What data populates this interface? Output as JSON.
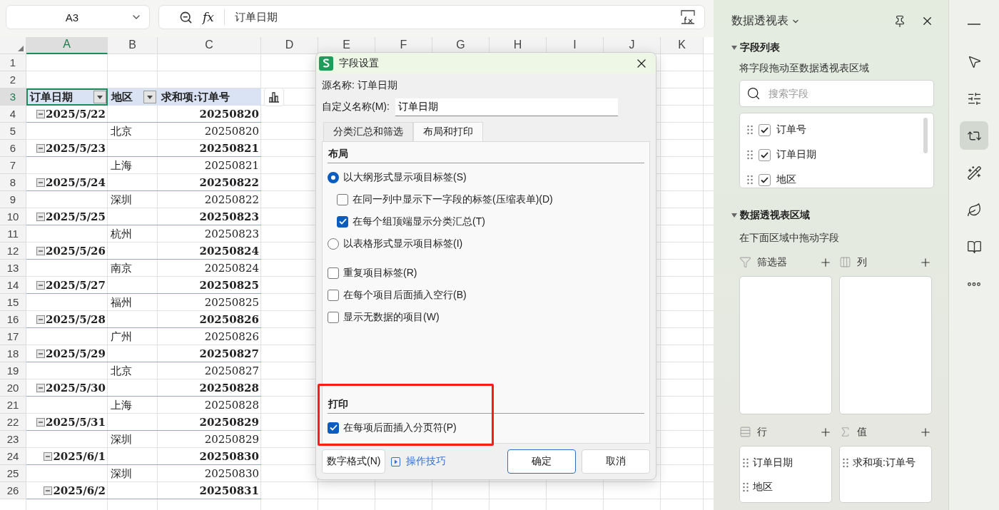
{
  "name_box": {
    "value": "A3"
  },
  "formula_bar": {
    "fx": "fx",
    "value": "订单日期"
  },
  "sheet": {
    "columns": [
      {
        "label": "A",
        "selected": true
      },
      {
        "label": "B",
        "selected": false
      },
      {
        "label": "C",
        "selected": false
      },
      {
        "label": "D",
        "selected": false
      },
      {
        "label": "E",
        "selected": false
      },
      {
        "label": "F",
        "selected": false
      },
      {
        "label": "G",
        "selected": false
      },
      {
        "label": "H",
        "selected": false
      },
      {
        "label": "I",
        "selected": false
      },
      {
        "label": "J",
        "selected": false
      },
      {
        "label": "K",
        "selected": false
      }
    ],
    "rows": [
      {
        "number": "1",
        "kind": "empty",
        "selected": false
      },
      {
        "number": "2",
        "kind": "empty",
        "selected": false
      },
      {
        "number": "3",
        "kind": "header",
        "selected": true,
        "cells": [
          {
            "label": "订单日期",
            "filter": true,
            "selected": true
          },
          {
            "label": "地区",
            "filter": true,
            "selected": false
          },
          {
            "label": "求和项:订单号",
            "filter": false,
            "selected": false
          }
        ]
      },
      {
        "number": "4",
        "kind": "date",
        "selected": false,
        "label": "2025/5/22",
        "value": "20250820",
        "expanded": true
      },
      {
        "number": "5",
        "kind": "region",
        "selected": false,
        "label": "北京",
        "value": "20250820"
      },
      {
        "number": "6",
        "kind": "date",
        "selected": false,
        "label": "2025/5/23",
        "value": "20250821",
        "expanded": true
      },
      {
        "number": "7",
        "kind": "region",
        "selected": false,
        "label": "上海",
        "value": "20250821"
      },
      {
        "number": "8",
        "kind": "date",
        "selected": false,
        "label": "2025/5/24",
        "value": "20250822",
        "expanded": true
      },
      {
        "number": "9",
        "kind": "region",
        "selected": false,
        "label": "深圳",
        "value": "20250822"
      },
      {
        "number": "10",
        "kind": "date",
        "selected": false,
        "label": "2025/5/25",
        "value": "20250823",
        "expanded": true
      },
      {
        "number": "11",
        "kind": "region",
        "selected": false,
        "label": "杭州",
        "value": "20250823"
      },
      {
        "number": "12",
        "kind": "date",
        "selected": false,
        "label": "2025/5/26",
        "value": "20250824",
        "expanded": true
      },
      {
        "number": "13",
        "kind": "region",
        "selected": false,
        "label": "南京",
        "value": "20250824"
      },
      {
        "number": "14",
        "kind": "date",
        "selected": false,
        "label": "2025/5/27",
        "value": "20250825",
        "expanded": true
      },
      {
        "number": "15",
        "kind": "region",
        "selected": false,
        "label": "福州",
        "value": "20250825"
      },
      {
        "number": "16",
        "kind": "date",
        "selected": false,
        "label": "2025/5/28",
        "value": "20250826",
        "expanded": true
      },
      {
        "number": "17",
        "kind": "region",
        "selected": false,
        "label": "广州",
        "value": "20250826"
      },
      {
        "number": "18",
        "kind": "date",
        "selected": false,
        "label": "2025/5/29",
        "value": "20250827",
        "expanded": true
      },
      {
        "number": "19",
        "kind": "region",
        "selected": false,
        "label": "北京",
        "value": "20250827"
      },
      {
        "number": "20",
        "kind": "date",
        "selected": false,
        "label": "2025/5/30",
        "value": "20250828",
        "expanded": true
      },
      {
        "number": "21",
        "kind": "region",
        "selected": false,
        "label": "上海",
        "value": "20250828"
      },
      {
        "number": "22",
        "kind": "date",
        "selected": false,
        "label": "2025/5/31",
        "value": "20250829",
        "expanded": true
      },
      {
        "number": "23",
        "kind": "region",
        "selected": false,
        "label": "深圳",
        "value": "20250829"
      },
      {
        "number": "24",
        "kind": "date",
        "selected": false,
        "label": "2025/6/1",
        "value": "20250830",
        "expanded": true
      },
      {
        "number": "25",
        "kind": "region",
        "selected": false,
        "label": "深圳",
        "value": "20250830"
      },
      {
        "number": "26",
        "kind": "date",
        "selected": false,
        "label": "2025/6/2",
        "value": "20250831",
        "expanded": true
      }
    ]
  },
  "dialog": {
    "title": "字段设置",
    "source_label": "源名称: 订单日期",
    "custom_name_label": "自定义名称(M):",
    "custom_name_value": "订单日期",
    "tabs": [
      {
        "label": "分类汇总和筛选",
        "selected": false
      },
      {
        "label": "布局和打印",
        "selected": true
      }
    ],
    "sections": [
      {
        "title": "布局",
        "highlighted": false,
        "options": [
          {
            "kind": "radio",
            "label": "以大纲形式显示项目标签(S)",
            "selected": true,
            "children": [
              {
                "kind": "checkbox",
                "label": "在同一列中显示下一字段的标签(压缩表单)(D)",
                "checked": false
              },
              {
                "kind": "checkbox",
                "label": "在每个组顶端显示分类汇总(T)",
                "checked": true
              }
            ]
          },
          {
            "kind": "radio",
            "label": "以表格形式显示项目标签(I)",
            "selected": false
          },
          {
            "kind": "checkbox",
            "label": "重复项目标签(R)",
            "checked": false
          },
          {
            "kind": "checkbox",
            "label": "在每个项目后面插入空行(B)",
            "checked": false
          },
          {
            "kind": "checkbox",
            "label": "显示无数据的项目(W)",
            "checked": false
          }
        ]
      },
      {
        "title": "打印",
        "highlighted": true,
        "options": [
          {
            "kind": "checkbox",
            "label": "在每项后面插入分页符(P)",
            "checked": true
          }
        ]
      }
    ],
    "number_format_button": "数字格式(N)",
    "tips_link": "操作技巧",
    "ok_button": "确定",
    "cancel_button": "取消"
  },
  "pivot_panel": {
    "title": "数据透视表",
    "field_list": {
      "title": "字段列表",
      "expanded": true,
      "hint": "将字段拖动至数据透视表区域",
      "search_placeholder": "搜索字段",
      "fields": [
        {
          "label": "订单号",
          "checked": true
        },
        {
          "label": "订单日期",
          "checked": true
        },
        {
          "label": "地区",
          "checked": true
        }
      ]
    },
    "areas": {
      "title": "数据透视表区域",
      "expanded": true,
      "hint": "在下面区域中拖动字段",
      "zones": [
        {
          "kind": "filter",
          "label": "筛选器"
        },
        {
          "kind": "columns",
          "label": "列"
        },
        {
          "kind": "rows",
          "label": "行",
          "items": [
            "订单日期",
            "地区"
          ]
        },
        {
          "kind": "values",
          "label": "值",
          "items": [
            "求和项:订单号"
          ]
        }
      ]
    }
  },
  "side_toolbar": [
    {
      "selected": false
    },
    {
      "selected": false
    },
    {
      "selected": false
    },
    {
      "selected": true
    },
    {
      "selected": false
    },
    {
      "selected": false
    },
    {
      "selected": false
    },
    {
      "selected": false
    }
  ]
}
